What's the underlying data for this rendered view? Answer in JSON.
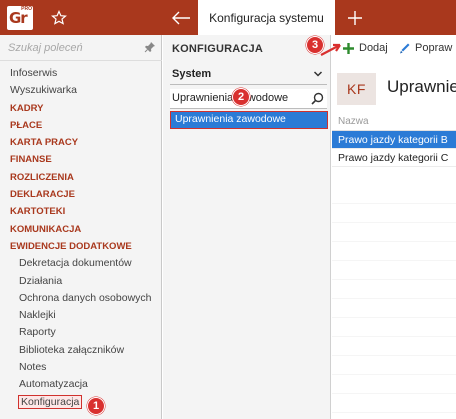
{
  "app": {
    "logo_text": "Gr",
    "logo_sup": "PRO",
    "active_tab": "Konfiguracja systemu",
    "accent_color": "#a9381d",
    "selection_color": "#2b7bd6",
    "annotation_color": "#d9302f"
  },
  "topbar": {
    "icons": [
      "star-icon",
      "back-arrow-icon",
      "plus-icon"
    ]
  },
  "sidebar": {
    "search_placeholder": "Szukaj poleceń",
    "items": [
      {
        "label": "Infoserwis",
        "type": "item"
      },
      {
        "label": "Wyszukiwarka",
        "type": "item"
      },
      {
        "label": "KADRY",
        "type": "category"
      },
      {
        "label": "PŁACE",
        "type": "category"
      },
      {
        "label": "KARTA PRACY",
        "type": "category"
      },
      {
        "label": "FINANSE",
        "type": "category"
      },
      {
        "label": "ROZLICZENIA",
        "type": "category"
      },
      {
        "label": "DEKLARACJE",
        "type": "category"
      },
      {
        "label": "KARTOTEKI",
        "type": "category"
      },
      {
        "label": "KOMUNIKACJA",
        "type": "category"
      },
      {
        "label": "EWIDENCJE DODATKOWE",
        "type": "category"
      },
      {
        "label": "Dekretacja dokumentów",
        "type": "sub"
      },
      {
        "label": "Działania",
        "type": "sub"
      },
      {
        "label": "Ochrona danych osobowych",
        "type": "sub"
      },
      {
        "label": "Naklejki",
        "type": "sub"
      },
      {
        "label": "Raporty",
        "type": "sub"
      },
      {
        "label": "Biblioteka załączników",
        "type": "sub"
      },
      {
        "label": "Notes",
        "type": "sub"
      },
      {
        "label": "Automatyzacja",
        "type": "sub"
      },
      {
        "label": "Konfiguracja",
        "type": "sub",
        "selected": true
      }
    ]
  },
  "middle": {
    "title": "KONFIGURACJA",
    "dropdown_value": "System",
    "filter_value": "Uprawnienia zawodowe",
    "selected_item": "Uprawnienia zawodowe"
  },
  "right": {
    "add_label": "Dodaj",
    "edit_label": "Popraw",
    "kf_label": "KF",
    "title": "Uprawnienia zawodowe",
    "column_header": "Nazwa",
    "rows": [
      "Prawo jazdy kategorii B",
      "Prawo jazdy kategorii C"
    ]
  },
  "annotations": {
    "badge1": "1",
    "badge2": "2",
    "badge3": "3"
  }
}
